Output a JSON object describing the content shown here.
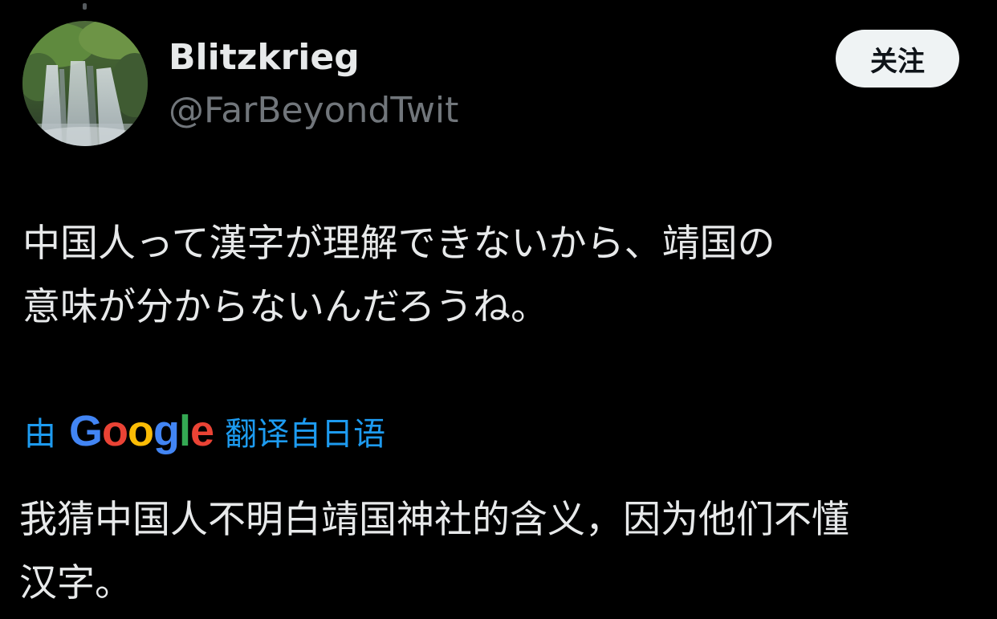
{
  "tweet": {
    "author": {
      "display_name": "Blitzkrieg",
      "handle": "@FarBeyondTwit",
      "avatar_icon": "waterfall-avatar"
    },
    "follow_label": "关注",
    "text_line_1": "中国人って漢字が理解できないから、靖国の",
    "text_line_2": "意味が分からないんだろうね。",
    "translation": {
      "prefix": "由",
      "service": "Google",
      "suffix": "翻译自日语",
      "text_line_1": "我猜中国人不明白靖国神社的含义，因为他们不懂",
      "text_line_2": "汉字。"
    }
  },
  "colors": {
    "background": "#000000",
    "primary_text": "#e7e9ea",
    "secondary_text": "#71767b",
    "link_blue": "#1d9bf0",
    "follow_button_bg": "#eff3f4",
    "follow_button_text": "#0f1419",
    "google_blue": "#4285f4",
    "google_red": "#ea4335",
    "google_yellow": "#fbbc05",
    "google_green": "#34a853"
  }
}
